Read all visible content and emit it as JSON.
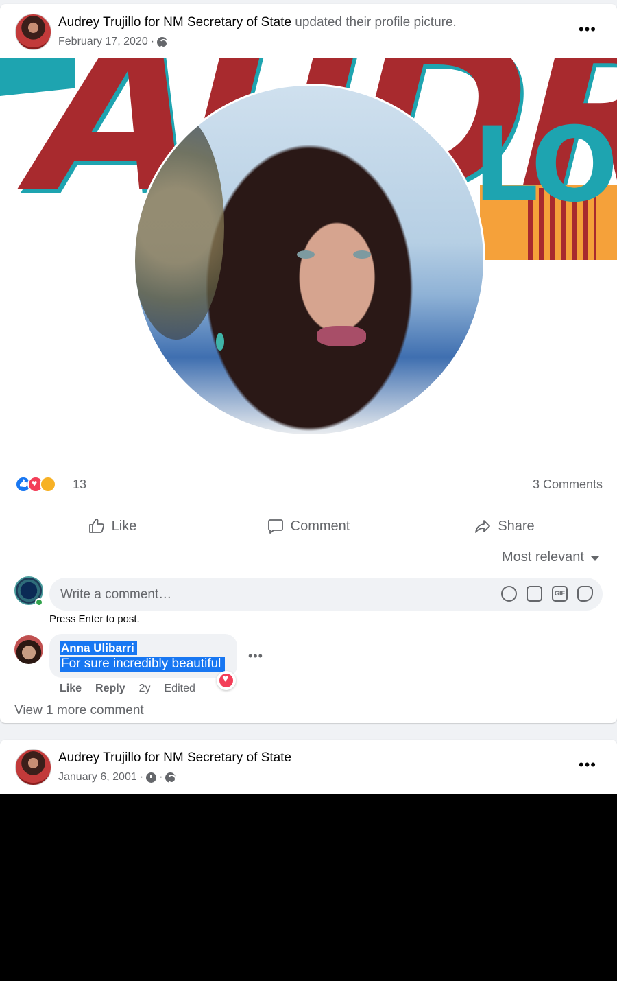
{
  "post1": {
    "page_name": "Audrey Trujillo for NM Secretary of State",
    "action": " updated their profile picture.",
    "date": "February 17, 2020",
    "reactions_count": "13",
    "comments_count": "3 Comments",
    "actions": {
      "like": "Like",
      "comment": "Comment",
      "share": "Share"
    },
    "sort_label": "Most relevant",
    "comment_placeholder": "Write a comment…",
    "press_enter": "Press Enter to post.",
    "comment": {
      "author": "Anna Ulibarri",
      "text": "For sure incredibly beautiful",
      "like": "Like",
      "reply": "Reply",
      "age": "2y",
      "edited": "Edited"
    },
    "view_more": "View 1 more comment",
    "input_tools": [
      "emoji-icon",
      "camera-icon",
      "gif-icon",
      "sticker-icon"
    ],
    "gif_label": "GIF"
  },
  "post2": {
    "page_name": "Audrey Trujillo for NM Secretary of State",
    "date": "January 6, 2001"
  },
  "colors": {
    "accent": "#1877f2",
    "love": "#f33e58",
    "banner_red": "#a82a2e",
    "banner_teal": "#1ea4b0"
  }
}
